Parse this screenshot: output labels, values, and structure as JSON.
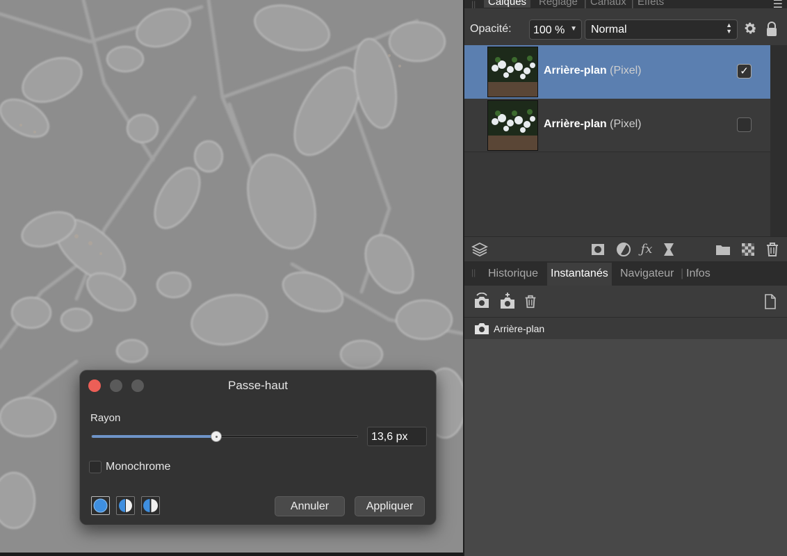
{
  "layers_panel": {
    "tabs": [
      "Calques",
      "Réglage",
      "Canaux",
      "Effets"
    ],
    "active_tab": "Calques",
    "opacity_label": "Opacité:",
    "opacity_value": "100 %",
    "blend_mode": "Normal",
    "layers": [
      {
        "name": "Arrière-plan",
        "type": "(Pixel)",
        "checked": "✓",
        "selected": true
      },
      {
        "name": "Arrière-plan",
        "type": "(Pixel)",
        "checked": "",
        "selected": false
      }
    ],
    "toolbar_icons": [
      "layers-stack-icon",
      "mask-icon",
      "adjustment-icon",
      "fx-icon",
      "live-filter-icon",
      "folder-icon",
      "pixel-layer-icon",
      "trash-icon"
    ]
  },
  "snapshots_panel": {
    "tabs": [
      "Historique",
      "Instantanés",
      "Navigateur",
      "Infos"
    ],
    "active_tab": "Instantanés",
    "snapshot_items": [
      "Arrière-plan"
    ]
  },
  "dialog": {
    "title": "Passe-haut",
    "rayon_label": "Rayon",
    "rayon_value": "13,6 px",
    "rayon_fraction": 0.47,
    "monochrome_label": "Monochrome",
    "cancel_label": "Annuler",
    "apply_label": "Appliquer"
  },
  "colors": {
    "selection": "#5b7fb0",
    "slider_fill": "#6e94c8",
    "close_button": "#ec5f57"
  }
}
